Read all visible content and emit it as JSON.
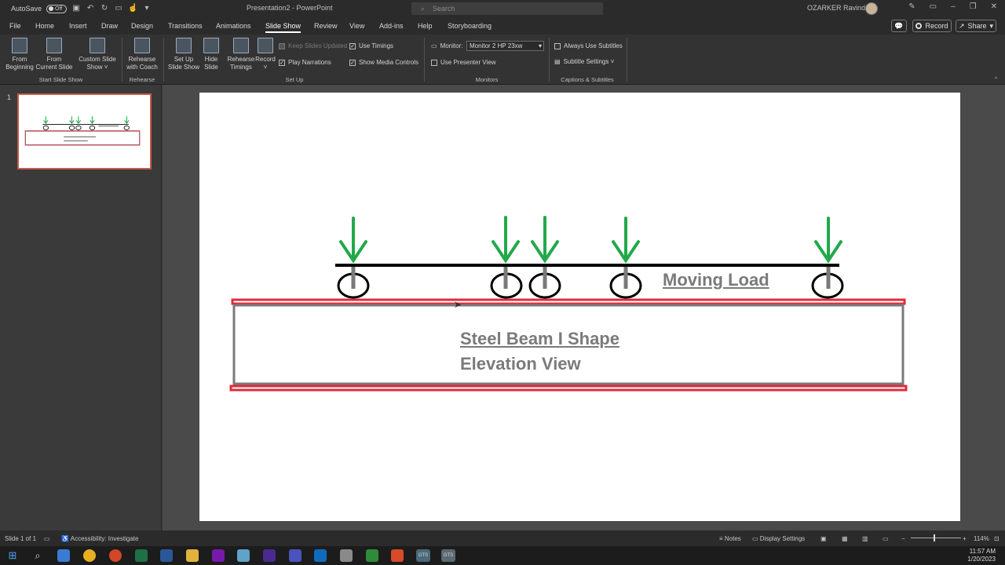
{
  "titlebar": {
    "autosave_label": "AutoSave",
    "autosave_state": "Off",
    "doc_title": "Presentation2 - PowerPoint",
    "search_placeholder": "Search",
    "user_name": "OZARKER Ravindra"
  },
  "menu": {
    "tabs": [
      "File",
      "Home",
      "Insert",
      "Draw",
      "Design",
      "Transitions",
      "Animations",
      "Slide Show",
      "Review",
      "View",
      "Add-ins",
      "Help",
      "Storyboarding"
    ],
    "active_tab": "Slide Show",
    "record_label": "Record",
    "share_label": "Share"
  },
  "ribbon": {
    "from_beginning_1": "From",
    "from_beginning_2": "Beginning",
    "from_current_1": "From",
    "from_current_2": "Current Slide",
    "custom_show_1": "Custom Slide",
    "custom_show_2": "Show ˅",
    "group_start": "Start Slide Show",
    "rehearse_coach_1": "Rehearse",
    "rehearse_coach_2": "with Coach",
    "group_rehearse": "Rehearse",
    "setup_show_1": "Set Up",
    "setup_show_2": "Slide Show",
    "hide_slide_1": "Hide",
    "hide_slide_2": "Slide",
    "rehearse_timings_1": "Rehearse",
    "rehearse_timings_2": "Timings",
    "record_1": "Record",
    "record_2": "˅",
    "keep_updated": "Keep Slides Updated",
    "use_timings": "Use Timings",
    "play_narrations": "Play Narrations",
    "show_media_controls": "Show Media Controls",
    "group_setup": "Set Up",
    "monitor_label": "Monitor:",
    "monitor_value": "Monitor 2 HP 23xw",
    "use_presenter_view": "Use Presenter View",
    "group_monitors": "Monitors",
    "always_subtitles": "Always Use Subtitles",
    "subtitle_settings": "Subtitle Settings ˅",
    "group_captions": "Captions & Subtitles"
  },
  "thumbnail": {
    "slide_number": "1"
  },
  "slide": {
    "moving_load": "Moving Load",
    "beam_line1": "Steel Beam I Shape",
    "beam_line2": "Elevation View"
  },
  "statusbar": {
    "slide_info": "Slide 1 of 1",
    "accessibility": "Accessibility: Investigate",
    "notes": "Notes",
    "display_settings": "Display Settings",
    "zoom": "114%"
  },
  "taskbar": {
    "time": "11:57 AM",
    "date": "1/20/2023",
    "gts1": "GTS",
    "gts2": "GTS"
  },
  "colors": {
    "arrow_green": "#22a94a",
    "beam_red": "#e02b3a",
    "beam_gray": "#7a7a7a"
  }
}
